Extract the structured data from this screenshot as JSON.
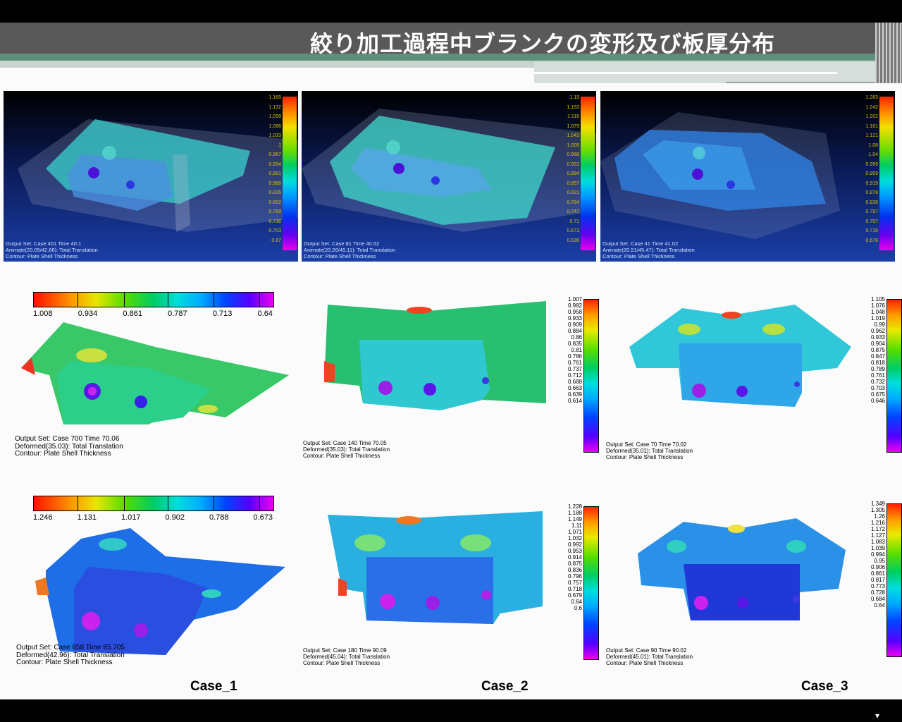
{
  "slide_title": "絞り加工過程中ブランクの変形及び板厚分布",
  "colors": {
    "header_band": "#595959",
    "header_accent": "#5e8f7a",
    "panel_bg": "#0a1a55"
  },
  "top_panels": [
    {
      "caption": [
        "Output Set: Case 401 Time 40.1",
        "Animate(20.05/42.66): Total Translation",
        "Contour: Plate Shell Thickness"
      ],
      "scale": [
        "1.165",
        "1.132",
        "1.099",
        "1.066",
        "1.033",
        "1",
        "0.967",
        "0.934",
        "0.901",
        "0.868",
        "0.835",
        "0.802",
        "0.769",
        "0.736",
        "0.703",
        "0.67"
      ]
    },
    {
      "caption": [
        "Output Set: Case 81 Time 40.52",
        "Animate(20.26/45.11): Total Translation",
        "Contour: Plate Shell Thickness"
      ],
      "scale": [
        "1.19",
        "1.153",
        "1.116",
        "1.079",
        "1.042",
        "1.005",
        "0.968",
        "0.931",
        "0.894",
        "0.857",
        "0.821",
        "0.784",
        "0.747",
        "0.71",
        "0.673",
        "0.636"
      ]
    },
    {
      "caption": [
        "Output Set: Case 41 Time 41.02",
        "Animate(20.51/45.47): Total Translation",
        "Contour: Plate Shell Thickness"
      ],
      "scale": [
        "1.283",
        "1.242",
        "1.202",
        "1.161",
        "1.121",
        "1.08",
        "1.04",
        "0.999",
        "0.959",
        "0.919",
        "0.878",
        "0.838",
        "0.797",
        "0.757",
        "0.716",
        "0.676"
      ]
    }
  ],
  "middle_row": {
    "case1": {
      "scale": [
        "1.008",
        "0.934",
        "0.861",
        "0.787",
        "0.713",
        "0.64"
      ],
      "caption": [
        "Output Set: Case 700 Time 70.06",
        "Deformed(35.03): Total Translation",
        "Contour: Plate Shell Thickness"
      ]
    },
    "case2": {
      "scale": [
        "1.007",
        "0.982",
        "0.958",
        "0.933",
        "0.909",
        "0.884",
        "0.86",
        "0.835",
        "0.81",
        "0.786",
        "0.761",
        "0.737",
        "0.712",
        "0.688",
        "0.663",
        "0.639",
        "0.614"
      ],
      "caption": [
        "Output Set: Case 140 Time 70.05",
        "Deformed(35.03): Total Translation",
        "Contour: Plate Shell Thickness"
      ]
    },
    "case3": {
      "scale": [
        "1.105",
        "1.076",
        "1.048",
        "1.019",
        "0.99",
        "0.962",
        "0.933",
        "0.904",
        "0.875",
        "0.847",
        "0.818",
        "0.789",
        "0.761",
        "0.732",
        "0.703",
        "0.675",
        "0.646"
      ],
      "caption": [
        "Output Set: Case 70 Time 70.02",
        "Deformed(35.01): Total Translation",
        "Contour: Plate Shell Thickness"
      ]
    }
  },
  "bottom_row": {
    "case1": {
      "scale": [
        "1.246",
        "1.131",
        "1.017",
        "0.902",
        "0.788",
        "0.673"
      ],
      "caption": [
        "Output Set: Case 858 Time 85.705",
        "Deformed(42.96): Total Translation",
        "Contour: Plate Shell Thickness"
      ]
    },
    "case2": {
      "scale": [
        "1.228",
        "1.188",
        "1.149",
        "1.11",
        "1.071",
        "1.032",
        "0.992",
        "0.953",
        "0.914",
        "0.875",
        "0.836",
        "0.796",
        "0.757",
        "0.718",
        "0.679",
        "0.64",
        "0.6"
      ],
      "caption": [
        "Output Set: Case 180 Time 90.09",
        "Deformed(45.04): Total Translation",
        "Contour: Plate Shell Thickness"
      ]
    },
    "case3": {
      "scale": [
        "1.349",
        "1.305",
        "1.26",
        "1.216",
        "1.172",
        "1.127",
        "1.083",
        "1.039",
        "0.994",
        "0.95",
        "0.906",
        "0.861",
        "0.817",
        "0.773",
        "0.728",
        "0.684",
        "0.64"
      ],
      "caption": [
        "Output Set: Case 90 Time 90.02",
        "Deformed(45.01): Total Translation",
        "Contour: Plate Shell Thickness"
      ]
    }
  },
  "case_labels": [
    "Case_1",
    "Case_2",
    "Case_3"
  ]
}
